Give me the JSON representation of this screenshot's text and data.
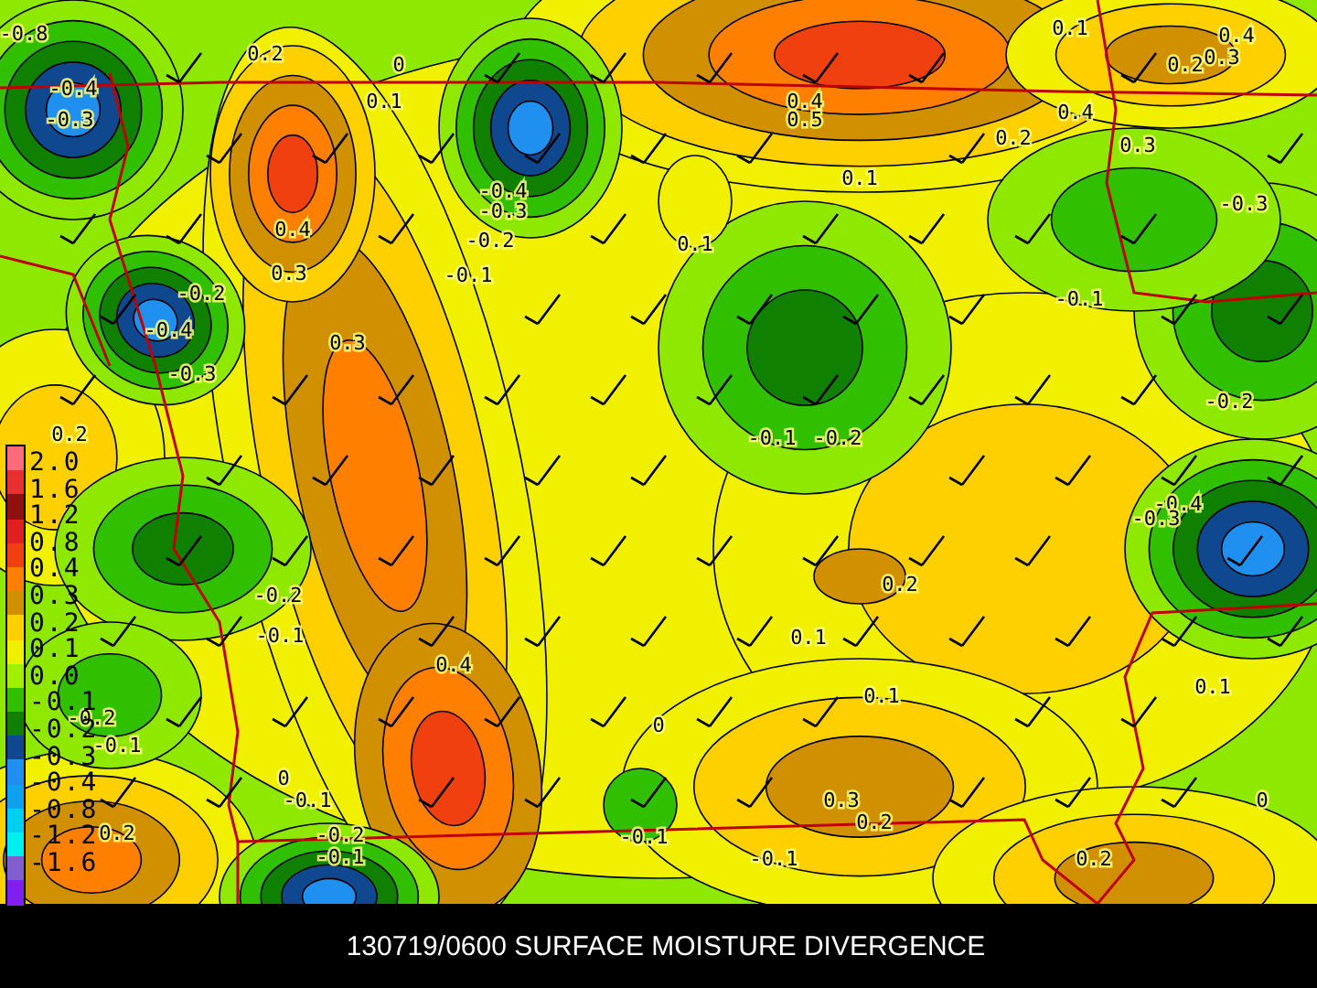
{
  "map": {
    "contour_labels": [
      "-0.8",
      "0.1",
      "0.4",
      "0.2",
      "0.2",
      "0.3",
      "0",
      "-0.4",
      "0.1",
      "0.4",
      "-0.3",
      "0.5",
      "0.4",
      "0.2",
      "0.3",
      "0.1",
      "-0.4",
      "-0.3",
      "-0.3",
      "0.4",
      "-0.2",
      "0.1",
      "0.3",
      "-0.1",
      "-0.2",
      "-0.1",
      "-0.4",
      "0.3",
      "-0.3",
      "-0.2",
      "0.2",
      "-0.1",
      "-0.2",
      "-0.4",
      "-0.3",
      "-0.2",
      "0.2",
      "-0.1",
      "0.1",
      "0.4",
      "0.1",
      "0.1",
      "-0.2",
      "0",
      "-0.1",
      "0",
      "-0.1",
      "0.3",
      "0",
      "0.2",
      "-0.2",
      "-0.1",
      "0.2",
      "-0.1",
      "-0.1",
      "0.2"
    ]
  },
  "legend": {
    "swatches": [
      {
        "color": "#ff6b78"
      },
      {
        "color": "#e83030"
      },
      {
        "color": "#901010"
      },
      {
        "color": "#e02020"
      },
      {
        "color": "#f04010"
      },
      {
        "color": "#ff8000"
      },
      {
        "color": "#d09000"
      },
      {
        "color": "#ffd000"
      },
      {
        "color": "#f0f000"
      },
      {
        "color": "#a0f000"
      },
      {
        "color": "#30c000"
      },
      {
        "color": "#108000"
      },
      {
        "color": "#104890"
      },
      {
        "color": "#2090f0"
      },
      {
        "color": "#10a0f0"
      },
      {
        "color": "#00d0f0"
      },
      {
        "color": "#00f0f0"
      },
      {
        "color": "#8060d0"
      },
      {
        "color": "#8020f0"
      }
    ],
    "labels": [
      "2.0",
      "1.6",
      "1.2",
      "0.8",
      "0.4",
      "0.3",
      "0.2",
      "0.1",
      "0.0",
      "-0.1",
      "-0.2",
      "-0.3",
      "-0.4",
      "-0.8",
      "-1.2",
      "-1.6"
    ]
  },
  "caption": "130719/0600 SURFACE MOISTURE DIVERGENCE"
}
